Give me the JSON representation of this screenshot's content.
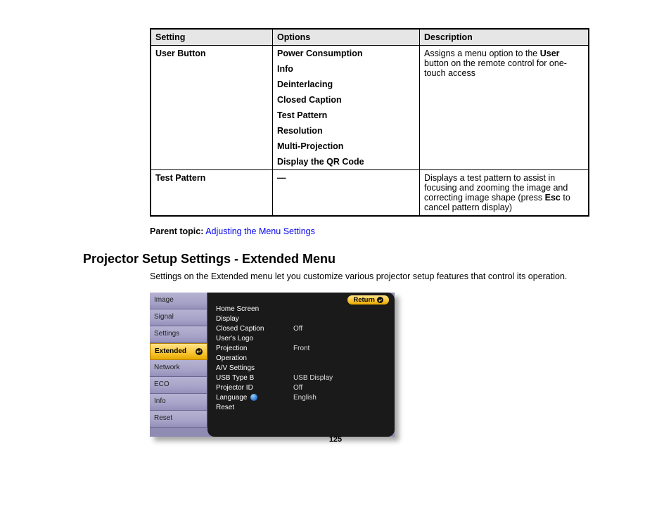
{
  "table": {
    "headers": [
      "Setting",
      "Options",
      "Description"
    ],
    "rows": [
      {
        "setting": "User Button",
        "options": [
          "Power Consumption",
          "Info",
          "Deinterlacing",
          "Closed Caption",
          "Test Pattern",
          "Resolution",
          "Multi-Projection",
          "Display the QR Code"
        ],
        "desc_pre": "Assigns a menu option to the ",
        "desc_bold": "User",
        "desc_post": " button on the remote control for one-touch access"
      },
      {
        "setting": "Test Pattern",
        "options": [
          "—"
        ],
        "desc_pre": "Displays a test pattern to assist in focusing and zooming the image and correcting image shape (press ",
        "desc_bold": "Esc",
        "desc_post": " to cancel pattern display)"
      }
    ]
  },
  "parent_topic": {
    "label": "Parent topic:",
    "link": "Adjusting the Menu Settings"
  },
  "section": {
    "heading": "Projector Setup Settings - Extended Menu",
    "intro": "Settings on the Extended menu let you customize various projector setup features that control its operation."
  },
  "osd": {
    "tabs": [
      "Image",
      "Signal",
      "Settings",
      "Extended",
      "Network",
      "ECO",
      "Info",
      "Reset"
    ],
    "selected_tab": "Extended",
    "return_label": "Return",
    "items": [
      {
        "label": "Home Screen",
        "value": ""
      },
      {
        "label": "Display",
        "value": ""
      },
      {
        "label": "Closed Caption",
        "value": "Off"
      },
      {
        "label": "User's Logo",
        "value": ""
      },
      {
        "label": "Projection",
        "value": "Front"
      },
      {
        "label": "Operation",
        "value": ""
      },
      {
        "label": "A/V Settings",
        "value": ""
      },
      {
        "label": "USB Type B",
        "value": "USB Display"
      },
      {
        "label": "Projector ID",
        "value": "Off"
      },
      {
        "label": "Language",
        "value": "English",
        "globe": true
      },
      {
        "label": "Reset",
        "value": ""
      }
    ]
  },
  "page_number": "125"
}
